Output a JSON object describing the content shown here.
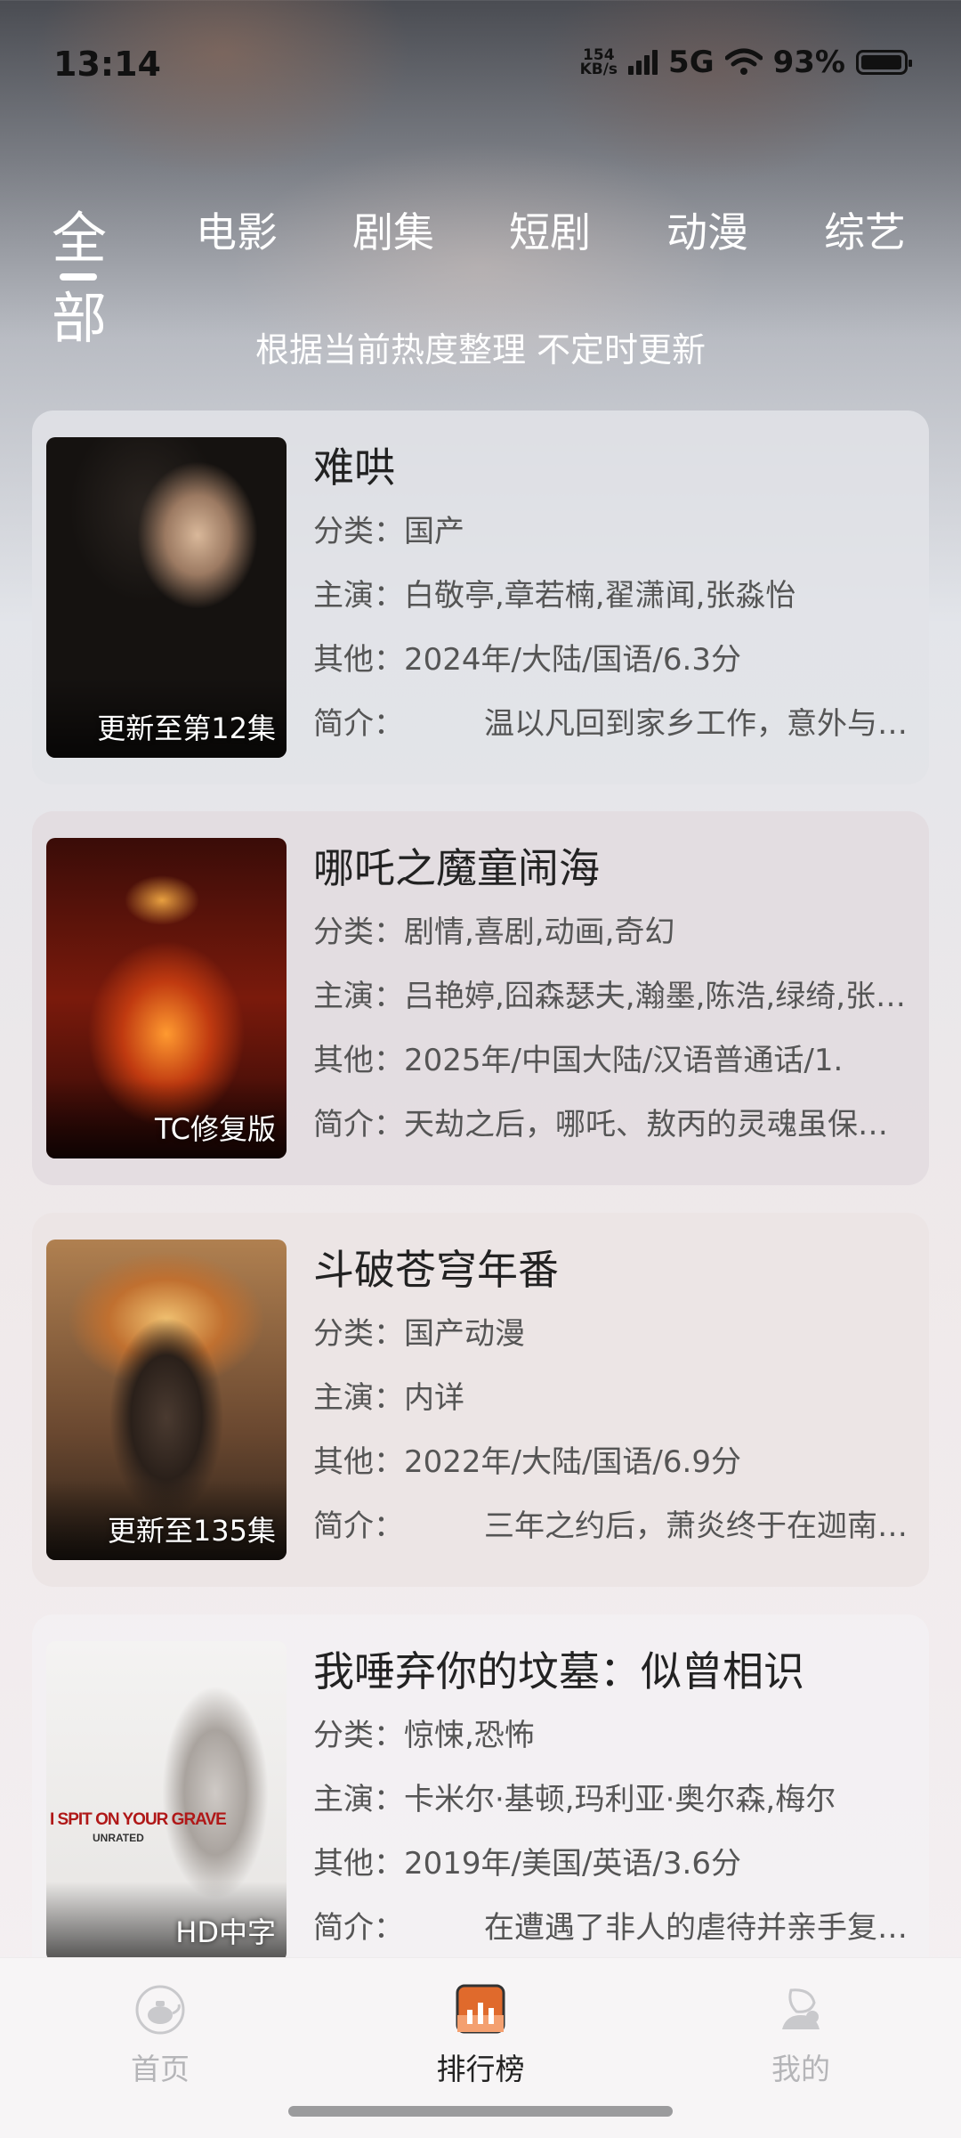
{
  "status": {
    "time": "13:14",
    "net_speed_value": "154",
    "net_speed_unit": "KB/s",
    "network": "5G",
    "battery": "93%"
  },
  "tabs": [
    {
      "label": "全部",
      "active": true
    },
    {
      "label": "电影",
      "active": false
    },
    {
      "label": "剧集",
      "active": false
    },
    {
      "label": "短剧",
      "active": false
    },
    {
      "label": "动漫",
      "active": false
    },
    {
      "label": "综艺",
      "active": false
    }
  ],
  "subtitle": "根据当前热度整理 不定时更新",
  "labels": {
    "genre": "分类：",
    "cast": "主演：",
    "other": "其他：",
    "summary": "简介："
  },
  "items": [
    {
      "title": "难哄",
      "genre": "国产",
      "cast": "白敬亭,章若楠,翟潇闻,张淼怡",
      "other": "2024年/大陆/国语/6.3分",
      "summary": "温以凡回到家乡工作，意外与桑延重逢",
      "badge": "更新至第12集"
    },
    {
      "title": "哪吒之魔童闹海",
      "genre": "剧情,喜剧,动画,奇幻",
      "cast": "吕艳婷,囧森瑟夫,瀚墨,陈浩,绿绮,张珈铭",
      "other": "2025年/中国大陆/汉语普通话/1.",
      "summary": "天劫之后，哪吒、敖丙的灵魂虽保住了",
      "badge": "TC修复版"
    },
    {
      "title": "斗破苍穹年番",
      "genre": "国产动漫",
      "cast": "内详",
      "other": "2022年/大陆/国语/6.9分",
      "summary": "三年之约后，萧炎终于在迦南学院",
      "badge": "更新至135集"
    },
    {
      "title": "我唾弃你的坟墓：似曾相识",
      "genre": "惊悚,恐怖",
      "cast": "卡米尔·基顿,玛利亚·奥尔森,梅尔",
      "other": "2019年/美国/英语/3.6分",
      "summary": "在遭遇了非人的虐待并亲手复仇之后",
      "badge": "HD中字",
      "poster_text_1": "I SPIT ON YOUR GRAVE",
      "poster_text_2": "UNRATED"
    }
  ],
  "nav": [
    {
      "label": "首页",
      "icon": "home-teapot-icon",
      "active": false
    },
    {
      "label": "排行榜",
      "icon": "ranking-chart-icon",
      "active": true
    },
    {
      "label": "我的",
      "icon": "profile-leaf-icon",
      "active": false
    }
  ],
  "colors": {
    "active_nav": "#222222",
    "inactive_nav": "#b5b5b8",
    "ranking_icon": "#e06a2c"
  }
}
